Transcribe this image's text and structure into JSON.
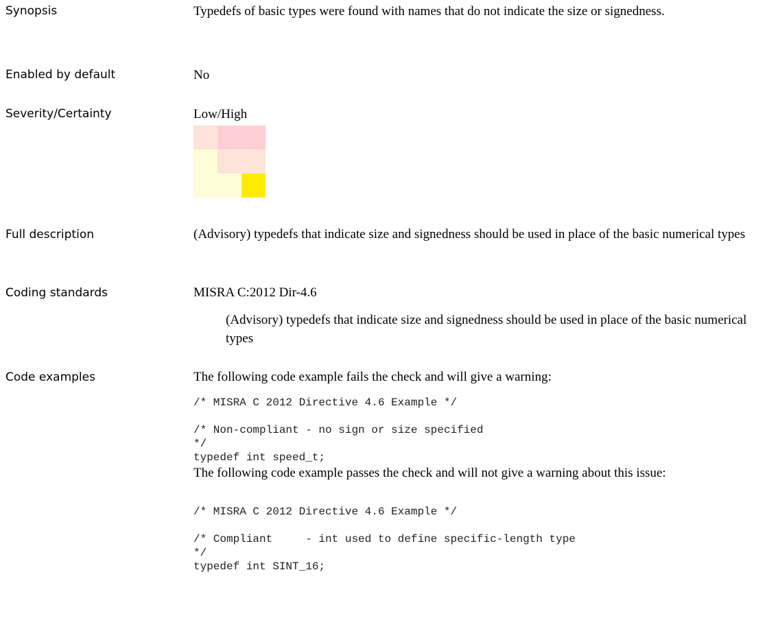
{
  "rows": {
    "synopsis": {
      "label": "Synopsis",
      "value": "Typedefs of basic types were found with names that do not indicate the size or signedness."
    },
    "enabled": {
      "label": "Enabled by default",
      "value": "No"
    },
    "severity": {
      "label": "Severity/Certainty",
      "value": "Low/High"
    },
    "full_description": {
      "label": "Full description",
      "value": "(Advisory) typedefs that indicate size and signedness should be used in place of the basic numerical types"
    },
    "coding_standards": {
      "label": "Coding standards",
      "standard": "MISRA C:2012 Dir-4.6",
      "standard_description": "(Advisory) typedefs that indicate size and signedness should be used in place of the basic numerical types"
    },
    "code_examples": {
      "label": "Code examples",
      "fail_intro": "The following code example fails the check and will give a warning:",
      "fail_code": "/* MISRA C 2012 Directive 4.6 Example */\n\n/* Non-compliant - no sign or size specified\n*/\ntypedef int speed_t;",
      "pass_intro": "The following code example passes the check and will not give a warning about this issue:",
      "pass_code": "/* MISRA C 2012 Directive 4.6 Example */\n\n/* Compliant     - int used to define specific-length type\n*/\ntypedef int SINT_16;"
    }
  },
  "severity_matrix": {
    "colors": [
      [
        "#fde3d8",
        "#fccfd4",
        "#fccfd4"
      ],
      [
        "#fefdd8",
        "#fde3d8",
        "#fde3d8"
      ],
      [
        "#fefdd8",
        "#fefdd8",
        "#ffec00"
      ]
    ]
  }
}
